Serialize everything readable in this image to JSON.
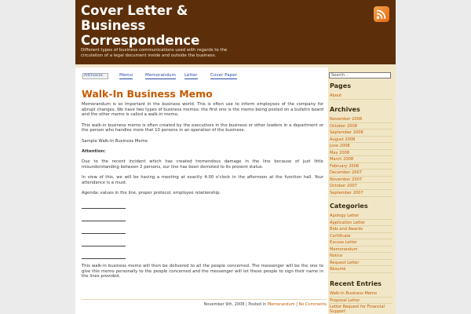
{
  "header": {
    "title": "Cover Letter & Business Correspondence",
    "description": "Different types of business communications used with regards to the circulation of a legal document inside and outside the business."
  },
  "ads": {
    "adchoices": "AdChoices",
    "links": [
      "Memo",
      "Memorandum",
      "Letter",
      "Cover Paper"
    ]
  },
  "post": {
    "title": "Walk-In Business Memo",
    "p1": "Memorandum is so important in the business world. This is often use to inform employees of the company for abrupt changes. We have two types of business memos: the first one is the memo being posted on a bulletin board and the other memo is called a walk-in memo.",
    "p2": "This walk-in business memo is often created by the executives in the business or other leaders in a department or the person who handles more that 10 persons in an operation of the business.",
    "p3": "Sample Walk-In Business Memo",
    "p4": "Attention:",
    "p5": "Due to the recent incident which has created tremendous damage in the line because of just little misunderstanding between 2 persons, our line has been demoted to its present status.",
    "p6": "In view of this, we will be having a meeting at exactly 4:00 o'clock in the afternoon at the function hall. Your attendance is a must.",
    "p7": "Agenda: values in the line, proper protocol, employee relationship.",
    "p8": "This walk-in business memo will then be delivered to all the people concerned. The messenger will be the one to give this memo personally to the people concerned and the messenger will let these people to sign their name in the lines provided.",
    "meta_date": "November 9th, 2008 | Posted in",
    "meta_category": "Memorandum",
    "meta_sep": "|",
    "meta_comments": "No Comments"
  },
  "sidebar": {
    "search_placeholder": "Search...",
    "pages_title": "Pages",
    "pages": [
      "About"
    ],
    "archives_title": "Archives",
    "archives": [
      "November 2008",
      "October 2008",
      "September 2008",
      "August 2008",
      "June 2008",
      "May 2008",
      "March 2008",
      "February 2008",
      "December 2007",
      "November 2007",
      "October 2007",
      "September 2007"
    ],
    "categories_title": "Categories",
    "categories": [
      "Apology Letter",
      "Application Letter",
      "Bids and Awards",
      "Certificate",
      "Excuse Letter",
      "Memorandum",
      "Notice",
      "Request Letter",
      "Résumé"
    ],
    "recent_title": "Recent Entries",
    "recent": [
      "Walk-In Business Memo",
      "Proposal Letter",
      "Letter Request for Financial Support"
    ]
  },
  "colors": {
    "header_bg": "#5c2f0a",
    "accent": "#c45a00",
    "sidebar_bg": "#f1e7c6",
    "rss": "#f6a34a"
  },
  "icons": {
    "rss": "rss-feed-icon"
  }
}
